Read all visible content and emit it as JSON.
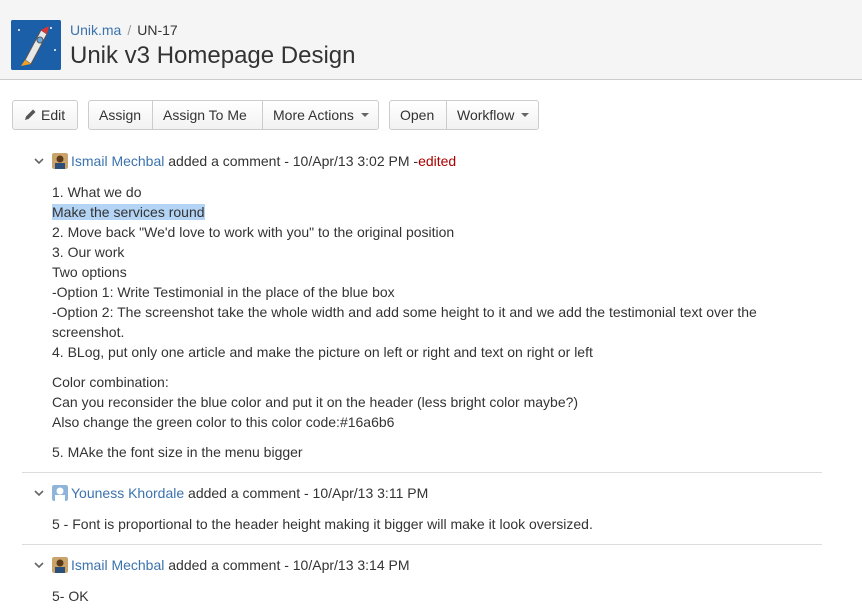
{
  "breadcrumb": {
    "project": "Unik.ma",
    "separator": "/",
    "key": "UN-17"
  },
  "issue": {
    "title": "Unik v3 Homepage Design"
  },
  "toolbar": {
    "edit": "Edit",
    "assign": "Assign",
    "assign_to_me": "Assign To Me",
    "more_actions": "More Actions",
    "open": "Open",
    "workflow": "Workflow"
  },
  "comments": [
    {
      "author": "Ismail Mechbal",
      "meta": "added a comment - 10/Apr/13 3:02 PM - ",
      "edited": "edited",
      "lines": [
        "1. What we do",
        "Make the services round",
        "2. Move back \"We'd love to work with you\" to the original position",
        "3. Our work",
        "Two options",
        "-Option 1: Write Testimonial in the place of the blue box",
        "-Option 2: The screenshot take the whole width and add some height to it and we add the testimonial text over the screenshot.",
        "4. BLog, put only one article and make the picture on left or right and text on right or left",
        "Color combination:",
        "Can you reconsider the blue color and put it on the header (less bright color maybe?)",
        "Also change the green color to this color code:#16a6b6",
        "5. MAke the font size in the menu bigger"
      ]
    },
    {
      "author": "Youness Khordale",
      "meta": "added a comment - 10/Apr/13 3:11 PM",
      "lines": [
        "5 - Font is proportional to the header height making it bigger will make it look oversized."
      ]
    },
    {
      "author": "Ismail Mechbal",
      "meta": "added a comment - 10/Apr/13 3:14 PM",
      "lines": [
        "5- OK"
      ]
    }
  ],
  "colors": {
    "link": "#3b73af",
    "edited": "#aa0000",
    "highlight": "#b3d4f5",
    "header_bg": "#f5f5f5"
  }
}
